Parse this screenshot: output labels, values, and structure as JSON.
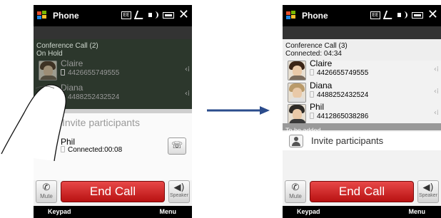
{
  "colors": {
    "end_call": "#c21b1b",
    "titlebar": "#000000",
    "hold_band": "#2c372c"
  },
  "left_screen": {
    "status_bar": {
      "app_title": "Phone",
      "icons": [
        "windows-logo-icon",
        "ee-icon",
        "signal-icon",
        "volume-icon",
        "battery-icon",
        "close-icon"
      ]
    },
    "call_header": {
      "title": "Conference Call (2)",
      "status": "On Hold"
    },
    "held_contacts": [
      {
        "name": "Claire",
        "number": "4426655749555"
      },
      {
        "name": "Diana",
        "number": "4488252432524"
      }
    ],
    "invite_label": "Invite participants",
    "connected_contact": {
      "name": "Phil",
      "status": "Connected:00:08"
    },
    "buttons": {
      "mute": "Mute",
      "end_call": "End Call",
      "speaker": "Speaker"
    },
    "softkeys": {
      "left": "Keypad",
      "right": "Menu"
    }
  },
  "right_screen": {
    "status_bar": {
      "app_title": "Phone",
      "icons": [
        "windows-logo-icon",
        "ee-icon",
        "signal-icon",
        "volume-icon",
        "battery-icon",
        "close-icon"
      ]
    },
    "call_header": {
      "title": "Conference Call (3)",
      "status": "Connected: 04:34"
    },
    "contacts": [
      {
        "name": "Claire",
        "number": "4426655749555"
      },
      {
        "name": "Diana",
        "number": "4488252432524"
      },
      {
        "name": "Phil",
        "number": "4412865038286"
      }
    ],
    "section_label": "To be added",
    "invite_label": "Invite participants",
    "buttons": {
      "mute": "Mute",
      "end_call": "End Call",
      "speaker": "Speaker"
    },
    "softkeys": {
      "left": "Keypad",
      "right": "Menu"
    }
  }
}
